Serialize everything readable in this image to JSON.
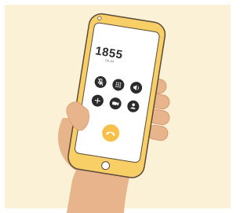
{
  "call": {
    "number": "1855",
    "status": "00:04"
  },
  "icons": {
    "row1": [
      "mute-icon",
      "keypad-icon",
      "speaker-icon"
    ],
    "row2": [
      "add-call-icon",
      "video-icon",
      "contacts-icon"
    ],
    "end": "end-call-icon"
  },
  "colors": {
    "background": "#fbf1d6",
    "phone_body": "#f7cf66",
    "phone_outline": "#5a4a3a",
    "screen": "#ffffff",
    "button_dark": "#2b2b2b",
    "end_call": "#f7c04a",
    "skin": "#e8b48c",
    "skin_shadow": "#d69b73"
  }
}
